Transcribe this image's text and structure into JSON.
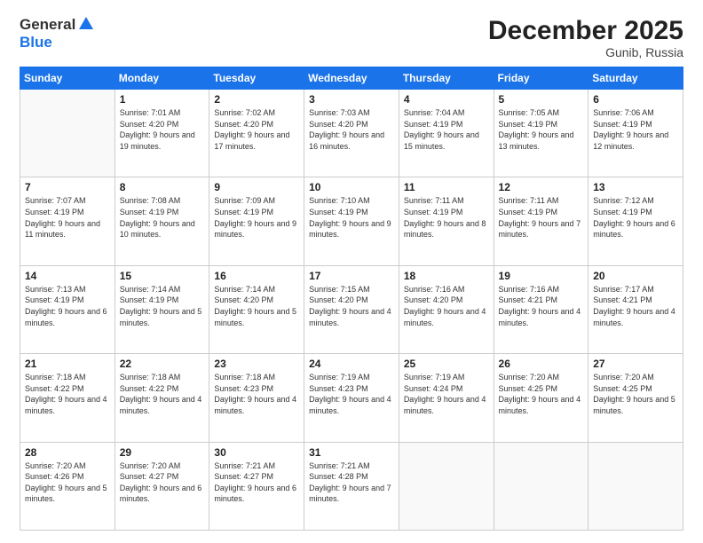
{
  "logo": {
    "line1": "General",
    "line2": "Blue"
  },
  "title": "December 2025",
  "location": "Gunib, Russia",
  "days_header": [
    "Sunday",
    "Monday",
    "Tuesday",
    "Wednesday",
    "Thursday",
    "Friday",
    "Saturday"
  ],
  "weeks": [
    [
      {
        "num": "",
        "sunrise": "",
        "sunset": "",
        "daylight": ""
      },
      {
        "num": "1",
        "sunrise": "Sunrise: 7:01 AM",
        "sunset": "Sunset: 4:20 PM",
        "daylight": "Daylight: 9 hours and 19 minutes."
      },
      {
        "num": "2",
        "sunrise": "Sunrise: 7:02 AM",
        "sunset": "Sunset: 4:20 PM",
        "daylight": "Daylight: 9 hours and 17 minutes."
      },
      {
        "num": "3",
        "sunrise": "Sunrise: 7:03 AM",
        "sunset": "Sunset: 4:20 PM",
        "daylight": "Daylight: 9 hours and 16 minutes."
      },
      {
        "num": "4",
        "sunrise": "Sunrise: 7:04 AM",
        "sunset": "Sunset: 4:19 PM",
        "daylight": "Daylight: 9 hours and 15 minutes."
      },
      {
        "num": "5",
        "sunrise": "Sunrise: 7:05 AM",
        "sunset": "Sunset: 4:19 PM",
        "daylight": "Daylight: 9 hours and 13 minutes."
      },
      {
        "num": "6",
        "sunrise": "Sunrise: 7:06 AM",
        "sunset": "Sunset: 4:19 PM",
        "daylight": "Daylight: 9 hours and 12 minutes."
      }
    ],
    [
      {
        "num": "7",
        "sunrise": "Sunrise: 7:07 AM",
        "sunset": "Sunset: 4:19 PM",
        "daylight": "Daylight: 9 hours and 11 minutes."
      },
      {
        "num": "8",
        "sunrise": "Sunrise: 7:08 AM",
        "sunset": "Sunset: 4:19 PM",
        "daylight": "Daylight: 9 hours and 10 minutes."
      },
      {
        "num": "9",
        "sunrise": "Sunrise: 7:09 AM",
        "sunset": "Sunset: 4:19 PM",
        "daylight": "Daylight: 9 hours and 9 minutes."
      },
      {
        "num": "10",
        "sunrise": "Sunrise: 7:10 AM",
        "sunset": "Sunset: 4:19 PM",
        "daylight": "Daylight: 9 hours and 9 minutes."
      },
      {
        "num": "11",
        "sunrise": "Sunrise: 7:11 AM",
        "sunset": "Sunset: 4:19 PM",
        "daylight": "Daylight: 9 hours and 8 minutes."
      },
      {
        "num": "12",
        "sunrise": "Sunrise: 7:11 AM",
        "sunset": "Sunset: 4:19 PM",
        "daylight": "Daylight: 9 hours and 7 minutes."
      },
      {
        "num": "13",
        "sunrise": "Sunrise: 7:12 AM",
        "sunset": "Sunset: 4:19 PM",
        "daylight": "Daylight: 9 hours and 6 minutes."
      }
    ],
    [
      {
        "num": "14",
        "sunrise": "Sunrise: 7:13 AM",
        "sunset": "Sunset: 4:19 PM",
        "daylight": "Daylight: 9 hours and 6 minutes."
      },
      {
        "num": "15",
        "sunrise": "Sunrise: 7:14 AM",
        "sunset": "Sunset: 4:19 PM",
        "daylight": "Daylight: 9 hours and 5 minutes."
      },
      {
        "num": "16",
        "sunrise": "Sunrise: 7:14 AM",
        "sunset": "Sunset: 4:20 PM",
        "daylight": "Daylight: 9 hours and 5 minutes."
      },
      {
        "num": "17",
        "sunrise": "Sunrise: 7:15 AM",
        "sunset": "Sunset: 4:20 PM",
        "daylight": "Daylight: 9 hours and 4 minutes."
      },
      {
        "num": "18",
        "sunrise": "Sunrise: 7:16 AM",
        "sunset": "Sunset: 4:20 PM",
        "daylight": "Daylight: 9 hours and 4 minutes."
      },
      {
        "num": "19",
        "sunrise": "Sunrise: 7:16 AM",
        "sunset": "Sunset: 4:21 PM",
        "daylight": "Daylight: 9 hours and 4 minutes."
      },
      {
        "num": "20",
        "sunrise": "Sunrise: 7:17 AM",
        "sunset": "Sunset: 4:21 PM",
        "daylight": "Daylight: 9 hours and 4 minutes."
      }
    ],
    [
      {
        "num": "21",
        "sunrise": "Sunrise: 7:18 AM",
        "sunset": "Sunset: 4:22 PM",
        "daylight": "Daylight: 9 hours and 4 minutes."
      },
      {
        "num": "22",
        "sunrise": "Sunrise: 7:18 AM",
        "sunset": "Sunset: 4:22 PM",
        "daylight": "Daylight: 9 hours and 4 minutes."
      },
      {
        "num": "23",
        "sunrise": "Sunrise: 7:18 AM",
        "sunset": "Sunset: 4:23 PM",
        "daylight": "Daylight: 9 hours and 4 minutes."
      },
      {
        "num": "24",
        "sunrise": "Sunrise: 7:19 AM",
        "sunset": "Sunset: 4:23 PM",
        "daylight": "Daylight: 9 hours and 4 minutes."
      },
      {
        "num": "25",
        "sunrise": "Sunrise: 7:19 AM",
        "sunset": "Sunset: 4:24 PM",
        "daylight": "Daylight: 9 hours and 4 minutes."
      },
      {
        "num": "26",
        "sunrise": "Sunrise: 7:20 AM",
        "sunset": "Sunset: 4:25 PM",
        "daylight": "Daylight: 9 hours and 4 minutes."
      },
      {
        "num": "27",
        "sunrise": "Sunrise: 7:20 AM",
        "sunset": "Sunset: 4:25 PM",
        "daylight": "Daylight: 9 hours and 5 minutes."
      }
    ],
    [
      {
        "num": "28",
        "sunrise": "Sunrise: 7:20 AM",
        "sunset": "Sunset: 4:26 PM",
        "daylight": "Daylight: 9 hours and 5 minutes."
      },
      {
        "num": "29",
        "sunrise": "Sunrise: 7:20 AM",
        "sunset": "Sunset: 4:27 PM",
        "daylight": "Daylight: 9 hours and 6 minutes."
      },
      {
        "num": "30",
        "sunrise": "Sunrise: 7:21 AM",
        "sunset": "Sunset: 4:27 PM",
        "daylight": "Daylight: 9 hours and 6 minutes."
      },
      {
        "num": "31",
        "sunrise": "Sunrise: 7:21 AM",
        "sunset": "Sunset: 4:28 PM",
        "daylight": "Daylight: 9 hours and 7 minutes."
      },
      {
        "num": "",
        "sunrise": "",
        "sunset": "",
        "daylight": ""
      },
      {
        "num": "",
        "sunrise": "",
        "sunset": "",
        "daylight": ""
      },
      {
        "num": "",
        "sunrise": "",
        "sunset": "",
        "daylight": ""
      }
    ]
  ]
}
